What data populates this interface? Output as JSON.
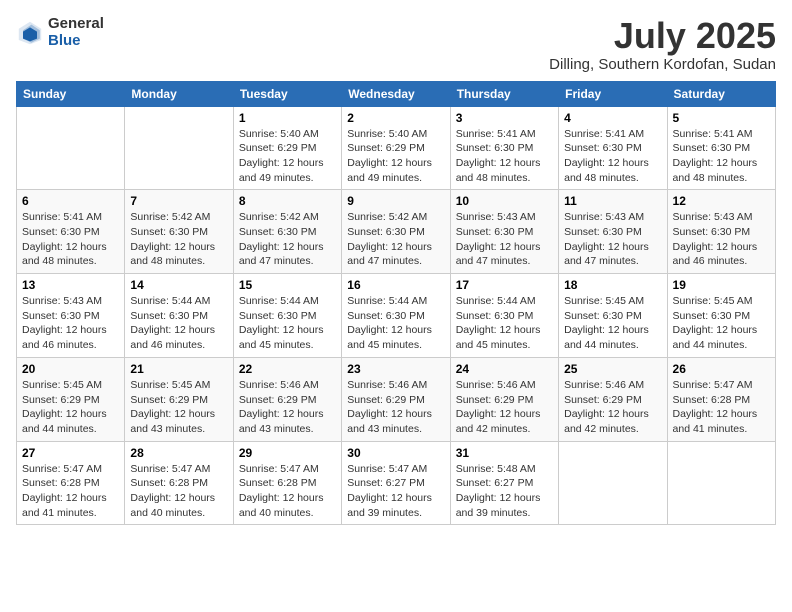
{
  "logo": {
    "general": "General",
    "blue": "Blue"
  },
  "title": {
    "month_year": "July 2025",
    "location": "Dilling, Southern Kordofan, Sudan"
  },
  "days_of_week": [
    "Sunday",
    "Monday",
    "Tuesday",
    "Wednesday",
    "Thursday",
    "Friday",
    "Saturday"
  ],
  "weeks": [
    [
      {
        "day": "",
        "info": ""
      },
      {
        "day": "",
        "info": ""
      },
      {
        "day": "1",
        "info": "Sunrise: 5:40 AM\nSunset: 6:29 PM\nDaylight: 12 hours and 49 minutes."
      },
      {
        "day": "2",
        "info": "Sunrise: 5:40 AM\nSunset: 6:29 PM\nDaylight: 12 hours and 49 minutes."
      },
      {
        "day": "3",
        "info": "Sunrise: 5:41 AM\nSunset: 6:30 PM\nDaylight: 12 hours and 48 minutes."
      },
      {
        "day": "4",
        "info": "Sunrise: 5:41 AM\nSunset: 6:30 PM\nDaylight: 12 hours and 48 minutes."
      },
      {
        "day": "5",
        "info": "Sunrise: 5:41 AM\nSunset: 6:30 PM\nDaylight: 12 hours and 48 minutes."
      }
    ],
    [
      {
        "day": "6",
        "info": "Sunrise: 5:41 AM\nSunset: 6:30 PM\nDaylight: 12 hours and 48 minutes."
      },
      {
        "day": "7",
        "info": "Sunrise: 5:42 AM\nSunset: 6:30 PM\nDaylight: 12 hours and 48 minutes."
      },
      {
        "day": "8",
        "info": "Sunrise: 5:42 AM\nSunset: 6:30 PM\nDaylight: 12 hours and 47 minutes."
      },
      {
        "day": "9",
        "info": "Sunrise: 5:42 AM\nSunset: 6:30 PM\nDaylight: 12 hours and 47 minutes."
      },
      {
        "day": "10",
        "info": "Sunrise: 5:43 AM\nSunset: 6:30 PM\nDaylight: 12 hours and 47 minutes."
      },
      {
        "day": "11",
        "info": "Sunrise: 5:43 AM\nSunset: 6:30 PM\nDaylight: 12 hours and 47 minutes."
      },
      {
        "day": "12",
        "info": "Sunrise: 5:43 AM\nSunset: 6:30 PM\nDaylight: 12 hours and 46 minutes."
      }
    ],
    [
      {
        "day": "13",
        "info": "Sunrise: 5:43 AM\nSunset: 6:30 PM\nDaylight: 12 hours and 46 minutes."
      },
      {
        "day": "14",
        "info": "Sunrise: 5:44 AM\nSunset: 6:30 PM\nDaylight: 12 hours and 46 minutes."
      },
      {
        "day": "15",
        "info": "Sunrise: 5:44 AM\nSunset: 6:30 PM\nDaylight: 12 hours and 45 minutes."
      },
      {
        "day": "16",
        "info": "Sunrise: 5:44 AM\nSunset: 6:30 PM\nDaylight: 12 hours and 45 minutes."
      },
      {
        "day": "17",
        "info": "Sunrise: 5:44 AM\nSunset: 6:30 PM\nDaylight: 12 hours and 45 minutes."
      },
      {
        "day": "18",
        "info": "Sunrise: 5:45 AM\nSunset: 6:30 PM\nDaylight: 12 hours and 44 minutes."
      },
      {
        "day": "19",
        "info": "Sunrise: 5:45 AM\nSunset: 6:30 PM\nDaylight: 12 hours and 44 minutes."
      }
    ],
    [
      {
        "day": "20",
        "info": "Sunrise: 5:45 AM\nSunset: 6:29 PM\nDaylight: 12 hours and 44 minutes."
      },
      {
        "day": "21",
        "info": "Sunrise: 5:45 AM\nSunset: 6:29 PM\nDaylight: 12 hours and 43 minutes."
      },
      {
        "day": "22",
        "info": "Sunrise: 5:46 AM\nSunset: 6:29 PM\nDaylight: 12 hours and 43 minutes."
      },
      {
        "day": "23",
        "info": "Sunrise: 5:46 AM\nSunset: 6:29 PM\nDaylight: 12 hours and 43 minutes."
      },
      {
        "day": "24",
        "info": "Sunrise: 5:46 AM\nSunset: 6:29 PM\nDaylight: 12 hours and 42 minutes."
      },
      {
        "day": "25",
        "info": "Sunrise: 5:46 AM\nSunset: 6:29 PM\nDaylight: 12 hours and 42 minutes."
      },
      {
        "day": "26",
        "info": "Sunrise: 5:47 AM\nSunset: 6:28 PM\nDaylight: 12 hours and 41 minutes."
      }
    ],
    [
      {
        "day": "27",
        "info": "Sunrise: 5:47 AM\nSunset: 6:28 PM\nDaylight: 12 hours and 41 minutes."
      },
      {
        "day": "28",
        "info": "Sunrise: 5:47 AM\nSunset: 6:28 PM\nDaylight: 12 hours and 40 minutes."
      },
      {
        "day": "29",
        "info": "Sunrise: 5:47 AM\nSunset: 6:28 PM\nDaylight: 12 hours and 40 minutes."
      },
      {
        "day": "30",
        "info": "Sunrise: 5:47 AM\nSunset: 6:27 PM\nDaylight: 12 hours and 39 minutes."
      },
      {
        "day": "31",
        "info": "Sunrise: 5:48 AM\nSunset: 6:27 PM\nDaylight: 12 hours and 39 minutes."
      },
      {
        "day": "",
        "info": ""
      },
      {
        "day": "",
        "info": ""
      }
    ]
  ]
}
